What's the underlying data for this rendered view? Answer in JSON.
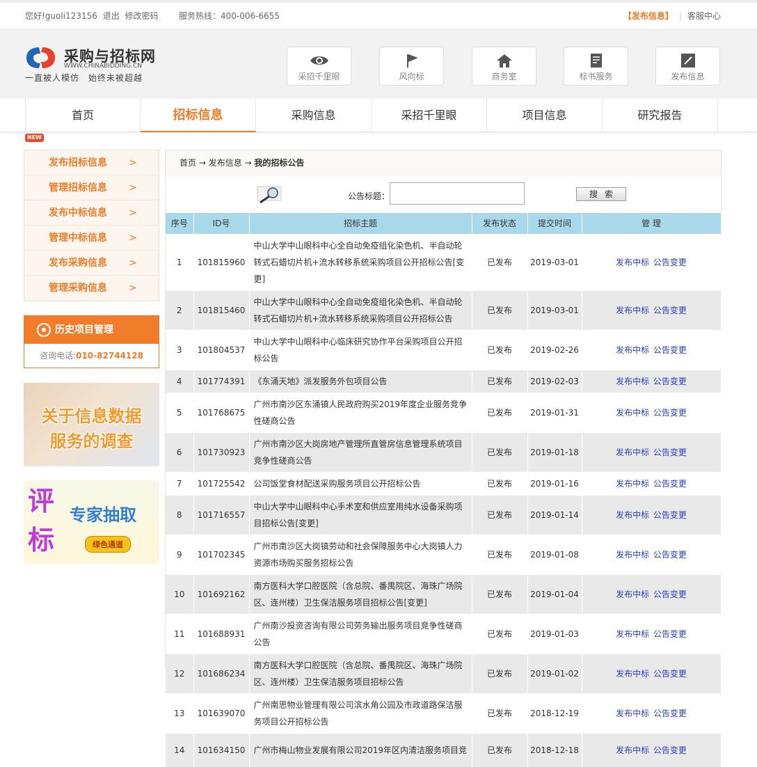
{
  "topbar": {
    "greeting": "您好!guoli123156",
    "logout": "退出",
    "change_password": "修改密码",
    "hotline": "服务热线：400-006-6655",
    "publish": "【发布信息】",
    "service": "客服中心"
  },
  "header": {
    "logo_name": "采购与招标网",
    "logo_url": "WWW.CHINABIDDING.CN",
    "slogan": "一直被人模仿　始终未被超越",
    "buttons": [
      {
        "label": "采招千里眼",
        "icon": "eye-icon"
      },
      {
        "label": "风向标",
        "icon": "flag-icon"
      },
      {
        "label": "商务室",
        "icon": "home-icon"
      },
      {
        "label": "标书服务",
        "icon": "document-icon"
      },
      {
        "label": "发布信息",
        "icon": "edit-icon"
      }
    ]
  },
  "nav": {
    "items": [
      "首页",
      "招标信息",
      "采购信息",
      "采招千里眼",
      "项目信息",
      "研究报告"
    ],
    "active": "招标信息",
    "new_badge": "NEW"
  },
  "sidebar": {
    "menu": [
      "发布招标信息",
      "管理招标信息",
      "发布中标信息",
      "管理中标信息",
      "发布采购信息",
      "管理采购信息"
    ],
    "arrow": ">",
    "history_title": "历史项目管理",
    "history_phone_label": "咨询电话:",
    "history_phone": "010-82744128",
    "banner1_line1": "关于信息数据",
    "banner1_line2": "服务的调查",
    "banner2_big1": "评",
    "banner2_big2": "标",
    "banner2_mid": "专家抽取",
    "banner2_pill": "绿色通道"
  },
  "breadcrumb": {
    "home": "首页",
    "arrow1": " → ",
    "section": "发布信息",
    "arrow2": " → ",
    "current": "我的招标公告"
  },
  "search": {
    "label": "公告标题：",
    "value": "",
    "button": "搜索"
  },
  "table": {
    "headers": [
      "序号",
      "ID号",
      "招标主题",
      "发布状态",
      "提交时间",
      "管 理"
    ],
    "op1": "发布中标",
    "op2": "公告变更",
    "rows": [
      {
        "no": "1",
        "id": "101815960",
        "topic": "中山大学中山眼科中心全自动免疫组化染色机、半自动轮转式石蜡切片机+流水转移系统采购项目公开招标公告[变更]",
        "status": "已发布",
        "date": "2019-03-01"
      },
      {
        "no": "2",
        "id": "101815460",
        "topic": "中山大学中山眼科中心全自动免疫组化染色机、半自动轮转式石蜡切片机+流水转移系统采购项目公开招标公告",
        "status": "已发布",
        "date": "2019-03-01"
      },
      {
        "no": "3",
        "id": "101804537",
        "topic": "中山大学中山眼科中心临床研究协作平台采购项目公开招标公告",
        "status": "已发布",
        "date": "2019-02-26"
      },
      {
        "no": "4",
        "id": "101774391",
        "topic": "《东涌天地》派发服务外包项目公告",
        "status": "已发布",
        "date": "2019-02-03"
      },
      {
        "no": "5",
        "id": "101768675",
        "topic": "广州市南沙区东涌镇人民政府购买2019年度企业服务竞争性磋商公告",
        "status": "已发布",
        "date": "2019-01-31"
      },
      {
        "no": "6",
        "id": "101730923",
        "topic": "广州市南沙区大岗房地产管理所直管房信息管理系统项目竞争性磋商公告",
        "status": "已发布",
        "date": "2019-01-18"
      },
      {
        "no": "7",
        "id": "101725542",
        "topic": "公司饭堂食材配送采购服务项目公开招标公告",
        "status": "已发布",
        "date": "2019-01-16"
      },
      {
        "no": "8",
        "id": "101716557",
        "topic": "中山大学中山眼科中心手术室和供应室用纯水设备采购项目招标公告[变更]",
        "status": "已发布",
        "date": "2019-01-14"
      },
      {
        "no": "9",
        "id": "101702345",
        "topic": "广州市南沙区大岗镇劳动和社会保障服务中心大岗镇人力资源市场购买服务招标公告",
        "status": "已发布",
        "date": "2019-01-08"
      },
      {
        "no": "10",
        "id": "101692162",
        "topic": "南方医科大学口腔医院（含总院、番禺院区、海珠广场院区、连州楼）卫生保洁服务项目招标公告[变更]",
        "status": "已发布",
        "date": "2019-01-04"
      },
      {
        "no": "11",
        "id": "101688931",
        "topic": "广州南沙投资咨询有限公司劳务输出服务项目竞争性磋商公告",
        "status": "已发布",
        "date": "2019-01-03"
      },
      {
        "no": "12",
        "id": "101686234",
        "topic": "南方医科大学口腔医院（含总院、番禺院区、海珠广场院区、连州楼）卫生保洁服务项目招标公告",
        "status": "已发布",
        "date": "2019-01-02"
      },
      {
        "no": "13",
        "id": "101639070",
        "topic": "广州南思物业管理有限公司滨水角公园及市政道路保洁服务项目公开招标公告",
        "status": "已发布",
        "date": "2018-12-19"
      },
      {
        "no": "14",
        "id": "101634150",
        "topic": "广州市梅山物业发展有限公司2019年区内清洁服务项目竞",
        "status": "已发布",
        "date": "2018-12-18"
      }
    ]
  },
  "colors": {
    "accent": "#f07d2a",
    "table_header": "#a9d8ea",
    "row_alt": "#e9e9e9",
    "link": "#2b3fbd"
  }
}
